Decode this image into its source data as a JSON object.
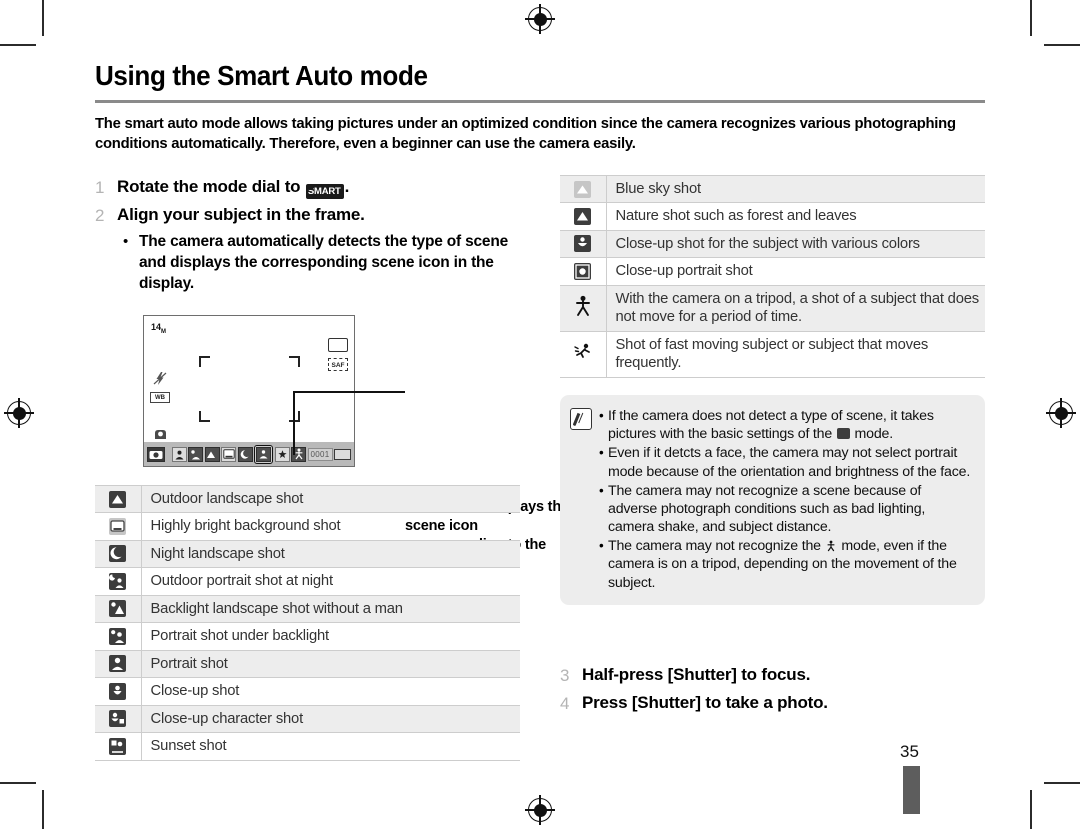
{
  "page": {
    "title": "Using the Smart Auto mode",
    "intro": "The smart auto mode allows taking pictures under an optimized condition since the camera recognizes various photographing conditions automatically. Therefore, even a beginner can use the camera easily.",
    "number": "35"
  },
  "steps": {
    "one": {
      "num": "1",
      "pre": "Rotate the mode dial to ",
      "dial_label": "SMART",
      "post": "."
    },
    "two": {
      "num": "2",
      "text": "Align your subject in the frame."
    },
    "two_bullet": "The camera automatically detects the type of scene and displays the corresponding scene icon in the display.",
    "three": {
      "num": "3",
      "pre": "Half-press ",
      "key": "[Shutter]",
      "post": " to focus."
    },
    "four": {
      "num": "4",
      "pre": "Press ",
      "key": "[Shutter]",
      "post": " to take a photo."
    }
  },
  "lcd": {
    "resolution": "14",
    "resolution_unit": "M",
    "frame_icon": "frame-icon",
    "af_label": "SAF",
    "side_icons": [
      "flash-off-icon",
      "white-balance-icon",
      "anti-shake-icon"
    ],
    "counter": "0001",
    "battery_icon": "battery-icon",
    "status_icons": [
      "smart-mode-icon",
      "portrait-icon",
      "backlight-portrait-icon",
      "landscape-icon",
      "white-background-icon",
      "night-icon",
      "macro-color-icon",
      "action-icon",
      "tripod-icon"
    ],
    "selected_status_icon": "macro-color-icon"
  },
  "callout": {
    "text": "The camera displays the scene icon corresponding to the scene it detects."
  },
  "scene_table_left": {
    "rows": [
      {
        "icon": "landscape-icon",
        "label": "Outdoor landscape shot"
      },
      {
        "icon": "white-background-icon",
        "label": "Highly bright background shot"
      },
      {
        "icon": "night-landscape-icon",
        "label": "Night landscape shot"
      },
      {
        "icon": "night-portrait-icon",
        "label": "Outdoor portrait shot at night"
      },
      {
        "icon": "backlight-landscape-icon",
        "label": "Backlight landscape shot without a man"
      },
      {
        "icon": "backlight-portrait-icon",
        "label": "Portrait shot under backlight"
      },
      {
        "icon": "portrait-icon",
        "label": "Portrait shot"
      },
      {
        "icon": "macro-icon",
        "label": "Close-up shot"
      },
      {
        "icon": "macro-text-icon",
        "label": "Close-up character shot"
      },
      {
        "icon": "sunset-icon",
        "label": "Sunset shot"
      }
    ]
  },
  "scene_table_right": {
    "rows": [
      {
        "icon": "blue-sky-icon",
        "label": "Blue sky shot"
      },
      {
        "icon": "nature-icon",
        "label": "Nature shot such as forest and leaves"
      },
      {
        "icon": "macro-color-icon",
        "label": "Close-up shot for the subject with various colors"
      },
      {
        "icon": "macro-portrait-icon",
        "label": "Close-up portrait shot"
      },
      {
        "icon": "tripod-icon",
        "label": "With the camera on a tripod, a shot of a subject that does not move for a period of time."
      },
      {
        "icon": "action-icon",
        "label": "Shot of fast moving subject or subject that moves frequently."
      }
    ]
  },
  "note": {
    "icon": "note-pencil-icon",
    "items": [
      {
        "pre": "If the camera does not detect a type of scene, it takes pictures with the basic settings of the ",
        "icon": "smart-mode-icon",
        "post": " mode."
      },
      {
        "pre": "Even if it detcts a face, the camera may not select portrait mode because of the orientation and brightness of the face.",
        "icon": "",
        "post": ""
      },
      {
        "pre": "The camera may not recognize a scene because of adverse photograph conditions such as bad lighting, camera shake, and subject distance.",
        "icon": "",
        "post": ""
      },
      {
        "pre": "The camera may not recognize the ",
        "icon": "tripod-icon",
        "post": " mode, even if the camera is on a tripod, depending on the movement of the subject."
      }
    ]
  }
}
